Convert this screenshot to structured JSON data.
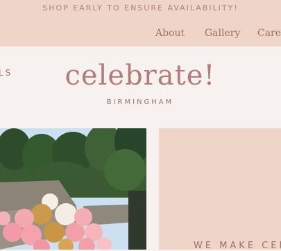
{
  "banner": {
    "text": "SHOP EARLY TO ENSURE AVAILABILITY!"
  },
  "nav": {
    "items": [
      {
        "label": "About"
      },
      {
        "label": "Gallery"
      },
      {
        "label": "Care"
      }
    ]
  },
  "header": {
    "left_cut_text": "LS",
    "logo_text": "celebrate!",
    "location": "BIRMINGHAM"
  },
  "hero": {
    "photo_alt": "Balloon arch in front of a house and trees"
  },
  "panel": {
    "heading": "WE MAKE CEL"
  },
  "colors": {
    "accent": "#b27d78",
    "blush": "#eed5c7",
    "background": "#f7f1ef"
  }
}
